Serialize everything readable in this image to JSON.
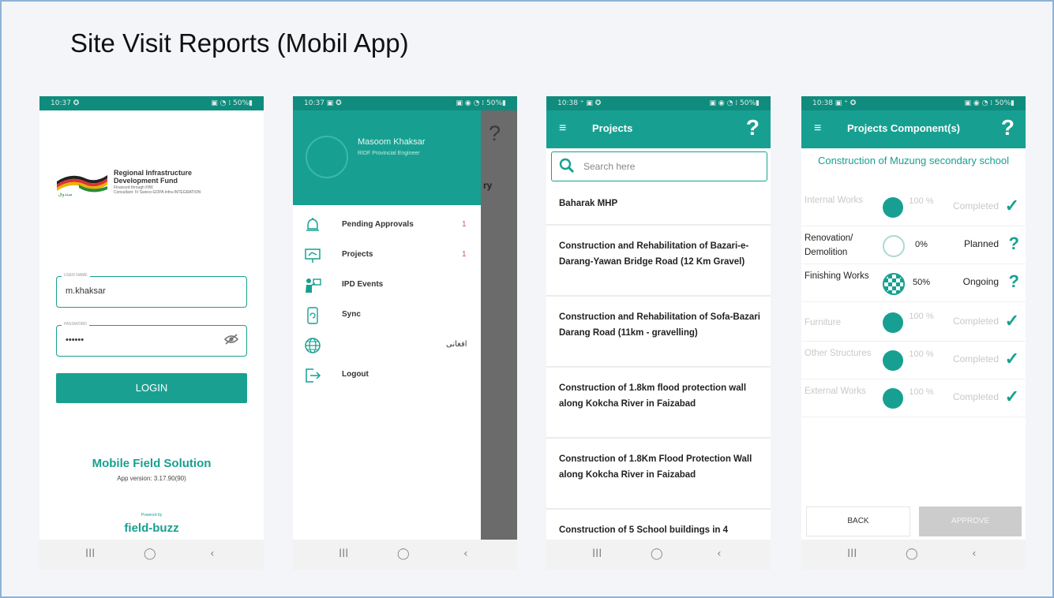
{
  "slide": {
    "title": "Site Visit Reports (Mobil App)"
  },
  "status_bars": [
    {
      "time": "10:37 ✪",
      "icons": "▣ ◔ ⁞ 50%▮"
    },
    {
      "time": "10:37 ▣ ✪",
      "icons": "▣ ◉ ◔ ⁞ 50%▮"
    },
    {
      "time": "10:38 ⁺ ▣ ✪",
      "icons": "▣ ◉ ◔ ⁞ 50%▮"
    },
    {
      "time": "10:38 ▣ ⁺ ✪",
      "icons": "▣ ◉ ◔ ⁞ 50%▮"
    }
  ],
  "navbar": {
    "recent": "III",
    "home": "◯",
    "back": "‹"
  },
  "login": {
    "org_line1": "Regional Infrastructure",
    "org_line2": "Development Fund",
    "org_line3": "Financed through KfW",
    "org_line4": "Consultant: IV Sweco-GOPA Infra-INTEGRATION",
    "username_label": "USER NAME",
    "username_value": "m.khaksar",
    "password_label": "PASSWORD",
    "password_value": "••••••",
    "login_button": "LOGIN",
    "brand": "Mobile Field Solution",
    "app_version": "App version: 3.17.90(90)",
    "powered_by": "Powered by",
    "vendor": "field-buzz"
  },
  "drawer": {
    "user_name": "Masoom Khaksar",
    "user_role": "RIDF Provincial Engineer",
    "peek_help": "?",
    "peek_text": "ry",
    "items": [
      {
        "label": "Pending Approvals",
        "count": "1"
      },
      {
        "label": "Projects",
        "count": "1"
      },
      {
        "label": "IPD Events",
        "count": ""
      },
      {
        "label": "Sync",
        "count": ""
      },
      {
        "label": "افغانی",
        "count": ""
      },
      {
        "label": "Logout",
        "count": ""
      }
    ]
  },
  "projects": {
    "title": "Projects",
    "help": "?",
    "search_placeholder": "Search here",
    "items": [
      "Baharak MHP",
      "Construction and Rehabilitation of Bazari-e-Darang-Yawan Bridge Road (12 Km Gravel)",
      "Construction and Rehabilitation of Sofa-Bazari Darang Road (11km - gravelling)",
      "Construction of 1.8km flood protection wall along Kokcha River in Faizabad",
      "Construction of 1.8Km Flood Protection Wall along Kokcha River in Faizabad",
      "Construction of 5 School buildings in 4"
    ]
  },
  "components": {
    "title": "Projects Component(s)",
    "help": "?",
    "project_name": "Construction of Muzung secondary school",
    "rows": [
      {
        "name": "Internal Works",
        "progress": "100 %",
        "status": "Completed",
        "mark": "✓",
        "fill": 1.0
      },
      {
        "name": "Renovation/ Demolition",
        "progress": "0%",
        "status": "Planned",
        "mark": "?",
        "fill": 0.0
      },
      {
        "name": "Finishing Works",
        "progress": "50%",
        "status": "Ongoing",
        "mark": "?",
        "fill": 0.5
      },
      {
        "name": "Furniture",
        "progress": "100 %",
        "status": "Completed",
        "mark": "✓",
        "fill": 1.0
      },
      {
        "name": "Other Structures",
        "progress": "100 %",
        "status": "Completed",
        "mark": "✓",
        "fill": 1.0
      },
      {
        "name": "External Works",
        "progress": "100 %",
        "status": "Completed",
        "mark": "✓",
        "fill": 1.0
      }
    ],
    "back_button": "BACK",
    "approve_button": "APPROVE"
  },
  "colors": {
    "accent": "#17a091",
    "statusbar": "#0f8c7d",
    "border": "#8fb3d6",
    "warning": "#d9534f"
  }
}
